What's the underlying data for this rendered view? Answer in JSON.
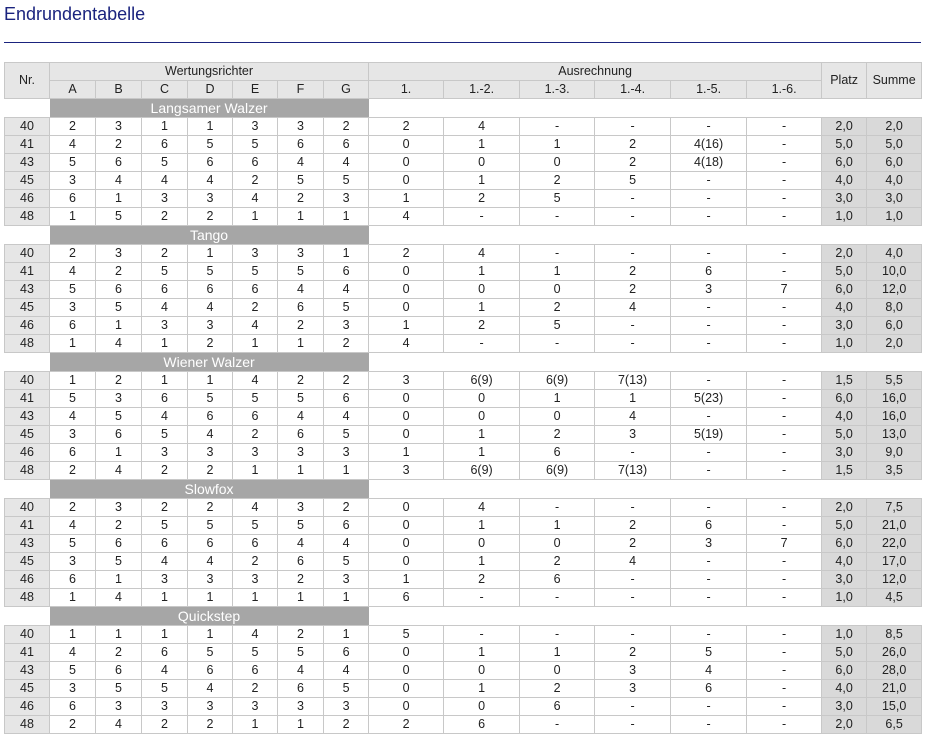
{
  "page": {
    "title": "Endrundentabelle"
  },
  "headers": {
    "nr": "Nr.",
    "judges_group": "Wertungsrichter",
    "calc_group": "Ausrechnung",
    "platz": "Platz",
    "summe": "Summe",
    "judges": [
      "A",
      "B",
      "C",
      "D",
      "E",
      "F",
      "G"
    ],
    "calc": [
      "1.",
      "1.-2.",
      "1.-3.",
      "1.-4.",
      "1.-5.",
      "1.-6."
    ]
  },
  "dances": [
    {
      "name": "Langsamer Walzer",
      "rows": [
        [
          "40",
          "2",
          "3",
          "1",
          "1",
          "3",
          "3",
          "2",
          "2",
          "4",
          "-",
          "-",
          "-",
          "-",
          "2,0",
          "2,0"
        ],
        [
          "41",
          "4",
          "2",
          "6",
          "5",
          "5",
          "6",
          "6",
          "0",
          "1",
          "1",
          "2",
          "4(16)",
          "-",
          "5,0",
          "5,0"
        ],
        [
          "43",
          "5",
          "6",
          "5",
          "6",
          "6",
          "4",
          "4",
          "0",
          "0",
          "0",
          "2",
          "4(18)",
          "-",
          "6,0",
          "6,0"
        ],
        [
          "45",
          "3",
          "4",
          "4",
          "4",
          "2",
          "5",
          "5",
          "0",
          "1",
          "2",
          "5",
          "-",
          "-",
          "4,0",
          "4,0"
        ],
        [
          "46",
          "6",
          "1",
          "3",
          "3",
          "4",
          "2",
          "3",
          "1",
          "2",
          "5",
          "-",
          "-",
          "-",
          "3,0",
          "3,0"
        ],
        [
          "48",
          "1",
          "5",
          "2",
          "2",
          "1",
          "1",
          "1",
          "4",
          "-",
          "-",
          "-",
          "-",
          "-",
          "1,0",
          "1,0"
        ]
      ]
    },
    {
      "name": "Tango",
      "rows": [
        [
          "40",
          "2",
          "3",
          "2",
          "1",
          "3",
          "3",
          "1",
          "2",
          "4",
          "-",
          "-",
          "-",
          "-",
          "2,0",
          "4,0"
        ],
        [
          "41",
          "4",
          "2",
          "5",
          "5",
          "5",
          "5",
          "6",
          "0",
          "1",
          "1",
          "2",
          "6",
          "-",
          "5,0",
          "10,0"
        ],
        [
          "43",
          "5",
          "6",
          "6",
          "6",
          "6",
          "4",
          "4",
          "0",
          "0",
          "0",
          "2",
          "3",
          "7",
          "6,0",
          "12,0"
        ],
        [
          "45",
          "3",
          "5",
          "4",
          "4",
          "2",
          "6",
          "5",
          "0",
          "1",
          "2",
          "4",
          "-",
          "-",
          "4,0",
          "8,0"
        ],
        [
          "46",
          "6",
          "1",
          "3",
          "3",
          "4",
          "2",
          "3",
          "1",
          "2",
          "5",
          "-",
          "-",
          "-",
          "3,0",
          "6,0"
        ],
        [
          "48",
          "1",
          "4",
          "1",
          "2",
          "1",
          "1",
          "2",
          "4",
          "-",
          "-",
          "-",
          "-",
          "-",
          "1,0",
          "2,0"
        ]
      ]
    },
    {
      "name": "Wiener Walzer",
      "rows": [
        [
          "40",
          "1",
          "2",
          "1",
          "1",
          "4",
          "2",
          "2",
          "3",
          "6(9)",
          "6(9)",
          "7(13)",
          "-",
          "-",
          "1,5",
          "5,5"
        ],
        [
          "41",
          "5",
          "3",
          "6",
          "5",
          "5",
          "5",
          "6",
          "0",
          "0",
          "1",
          "1",
          "5(23)",
          "-",
          "6,0",
          "16,0"
        ],
        [
          "43",
          "4",
          "5",
          "4",
          "6",
          "6",
          "4",
          "4",
          "0",
          "0",
          "0",
          "4",
          "-",
          "-",
          "4,0",
          "16,0"
        ],
        [
          "45",
          "3",
          "6",
          "5",
          "4",
          "2",
          "6",
          "5",
          "0",
          "1",
          "2",
          "3",
          "5(19)",
          "-",
          "5,0",
          "13,0"
        ],
        [
          "46",
          "6",
          "1",
          "3",
          "3",
          "3",
          "3",
          "3",
          "1",
          "1",
          "6",
          "-",
          "-",
          "-",
          "3,0",
          "9,0"
        ],
        [
          "48",
          "2",
          "4",
          "2",
          "2",
          "1",
          "1",
          "1",
          "3",
          "6(9)",
          "6(9)",
          "7(13)",
          "-",
          "-",
          "1,5",
          "3,5"
        ]
      ]
    },
    {
      "name": "Slowfox",
      "rows": [
        [
          "40",
          "2",
          "3",
          "2",
          "2",
          "4",
          "3",
          "2",
          "0",
          "4",
          "-",
          "-",
          "-",
          "-",
          "2,0",
          "7,5"
        ],
        [
          "41",
          "4",
          "2",
          "5",
          "5",
          "5",
          "5",
          "6",
          "0",
          "1",
          "1",
          "2",
          "6",
          "-",
          "5,0",
          "21,0"
        ],
        [
          "43",
          "5",
          "6",
          "6",
          "6",
          "6",
          "4",
          "4",
          "0",
          "0",
          "0",
          "2",
          "3",
          "7",
          "6,0",
          "22,0"
        ],
        [
          "45",
          "3",
          "5",
          "4",
          "4",
          "2",
          "6",
          "5",
          "0",
          "1",
          "2",
          "4",
          "-",
          "-",
          "4,0",
          "17,0"
        ],
        [
          "46",
          "6",
          "1",
          "3",
          "3",
          "3",
          "2",
          "3",
          "1",
          "2",
          "6",
          "-",
          "-",
          "-",
          "3,0",
          "12,0"
        ],
        [
          "48",
          "1",
          "4",
          "1",
          "1",
          "1",
          "1",
          "1",
          "6",
          "-",
          "-",
          "-",
          "-",
          "-",
          "1,0",
          "4,5"
        ]
      ]
    },
    {
      "name": "Quickstep",
      "rows": [
        [
          "40",
          "1",
          "1",
          "1",
          "1",
          "4",
          "2",
          "1",
          "5",
          "-",
          "-",
          "-",
          "-",
          "-",
          "1,0",
          "8,5"
        ],
        [
          "41",
          "4",
          "2",
          "6",
          "5",
          "5",
          "5",
          "6",
          "0",
          "1",
          "1",
          "2",
          "5",
          "-",
          "5,0",
          "26,0"
        ],
        [
          "43",
          "5",
          "6",
          "4",
          "6",
          "6",
          "4",
          "4",
          "0",
          "0",
          "0",
          "3",
          "4",
          "-",
          "6,0",
          "28,0"
        ],
        [
          "45",
          "3",
          "5",
          "5",
          "4",
          "2",
          "6",
          "5",
          "0",
          "1",
          "2",
          "3",
          "6",
          "-",
          "4,0",
          "21,0"
        ],
        [
          "46",
          "6",
          "3",
          "3",
          "3",
          "3",
          "3",
          "3",
          "0",
          "0",
          "6",
          "-",
          "-",
          "-",
          "3,0",
          "15,0"
        ],
        [
          "48",
          "2",
          "4",
          "2",
          "2",
          "1",
          "1",
          "2",
          "2",
          "6",
          "-",
          "-",
          "-",
          "-",
          "2,0",
          "6,5"
        ]
      ]
    }
  ]
}
